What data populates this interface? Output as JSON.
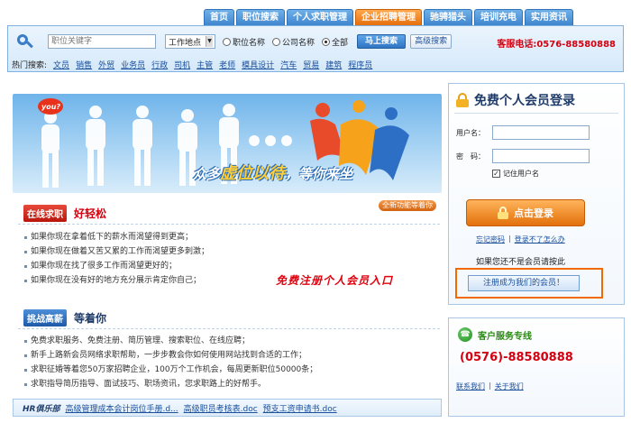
{
  "nav": {
    "tabs": [
      {
        "label": "首页",
        "active": false
      },
      {
        "label": "职位搜索",
        "active": false
      },
      {
        "label": "个人求职管理",
        "active": false
      },
      {
        "label": "企业招聘管理",
        "active": true
      },
      {
        "label": "驰骋猎头",
        "active": false
      },
      {
        "label": "培训充电",
        "active": false
      },
      {
        "label": "实用资讯",
        "active": false
      }
    ]
  },
  "search": {
    "keyword_placeholder": "职位关键字",
    "location_label": "工作地点",
    "radio_options": [
      {
        "label": "职位名称",
        "selected": false
      },
      {
        "label": "公司名称",
        "selected": false
      },
      {
        "label": "全部",
        "selected": true
      }
    ],
    "search_button": "马上搜索",
    "advanced_button": "高级搜索",
    "hotline": "客服电话:0576-88580888",
    "hot_label": "热门搜索:",
    "hot_terms": [
      "文员",
      "销售",
      "外贸",
      "业务员",
      "行政",
      "司机",
      "主管",
      "老师",
      "模具设计",
      "汽车",
      "贸易",
      "建筑",
      "程序员"
    ]
  },
  "banner": {
    "slogan_part1": "众多",
    "slogan_highlight": "虚位以待",
    "slogan_part2": "，等你来坐",
    "bubble_text": "you?"
  },
  "section1": {
    "badge": "在线求职",
    "title": "好轻松",
    "new_feature": "全新功能等着你",
    "items": [
      "如果你现在拿着低下的薪水而渴望得到更高；",
      "如果你现在做着又苦又累的工作而渴望更多刺激；",
      "如果你现在找了很多工作而渴望更好的；",
      "如果你现在没有好的地方充分展示肯定你自己；"
    ],
    "annotation": "免费注册个人会员入口"
  },
  "section2": {
    "badge": "挑战高薪",
    "title": "等着你",
    "items": [
      "免费求职服务、免费注册、简历管理、搜索职位、在线应聘；",
      "新手上路新会员网络求职帮助，一步步教会你如何使用网站找到合适的工作；",
      "求职征婚等着您50万家招聘企业，100万个工作机会，每周更新职位50000条；",
      "求职指导简历指导、面试技巧、职场资讯，您求职路上的好帮手。"
    ]
  },
  "club": {
    "label": "HR俱乐部",
    "links": [
      "高级管理成本会计岗位手册.d...",
      "高级职员考核表.doc",
      "预支工资申请书.doc"
    ]
  },
  "login": {
    "title": "免费个人会员登录",
    "username_label": "用户名：",
    "password_label": "密　码：",
    "remember_label": "记住用户名",
    "login_button": "点击登录",
    "forgot_password": "忘记密码",
    "cant_login": "登录不了怎么办",
    "not_member": "如果您还不是会员请按此",
    "register_button": "注册成为我们的会员！"
  },
  "service": {
    "title": "客户服务专线",
    "phone": "(0576)-88580888",
    "contact_link": "联系我们",
    "about_link": "关于我们"
  }
}
